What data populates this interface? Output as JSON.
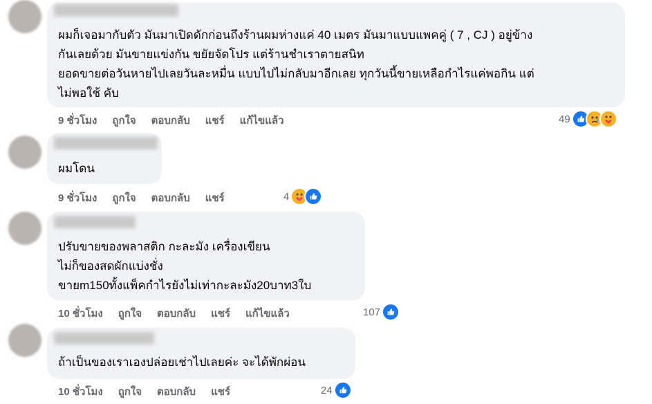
{
  "comments": [
    {
      "lines": [
        "ผมก็เจอมากับตัว มันมาเปิดดักก่อนถึงร้านผมห่างแค่ 40 เมตร มันมาแบบแพคคู่ ( 7 , CJ ) อยู่ข้าง",
        "กันเลยด้วย มันขายแข่งกัน ขยัยจัดโปร แต่ร้านชำเราตายสนิท",
        "ยอดขายต่อวันหายไปเลยวันละหมื่น แบบไปไม่กลับมาอีกเลย ทุกวันนี้ขายเหลือกำไรแค่พอกิน แต่",
        "ไม่พอใช้ คับ"
      ],
      "time": "9 ชั่วโมง",
      "like": "ถูกใจ",
      "reply": "ตอบกลับ",
      "share": "แชร์",
      "edited": "แก้ไขแล้ว",
      "reaction_count": "49",
      "reactions": [
        "like-icon",
        "sad-icon",
        "care-icon"
      ]
    },
    {
      "lines": [
        "ผมโดน"
      ],
      "time": "9 ชั่วโมง",
      "like": "ถูกใจ",
      "reply": "ตอบกลับ",
      "share": "แชร์",
      "reaction_count": "4",
      "reactions": [
        "care-icon",
        "like-icon"
      ]
    },
    {
      "lines": [
        "ปรับขายของพลาสติก กะละมัง เครื่องเขียน",
        "ไม่ก็ของสดผักแบ่งชั่ง",
        "ขายm150ทั้งแพ็คกำไรยังไม่เท่ากะละมัง20บาท3ใบ"
      ],
      "time": "10 ชั่วโมง",
      "like": "ถูกใจ",
      "reply": "ตอบกลับ",
      "share": "แชร์",
      "edited": "แก้ไขแล้ว",
      "reaction_count": "107",
      "reactions": [
        "like-icon"
      ]
    },
    {
      "lines": [
        "ถ้าเป็นของเราเองปล่อยเช่าไปเลยค่ะ จะได้พักผ่อน"
      ],
      "time": "10 ชั่วโมง",
      "like": "ถูกใจ",
      "reply": "ตอบกลับ",
      "share": "แชร์",
      "reaction_count": "24",
      "reactions": [
        "like-icon"
      ]
    }
  ],
  "colors": {
    "bubble": "#f0f2f5",
    "meta": "#65676b",
    "like_blue": "#1877f2",
    "emoji_yellow": "#f7b125"
  }
}
